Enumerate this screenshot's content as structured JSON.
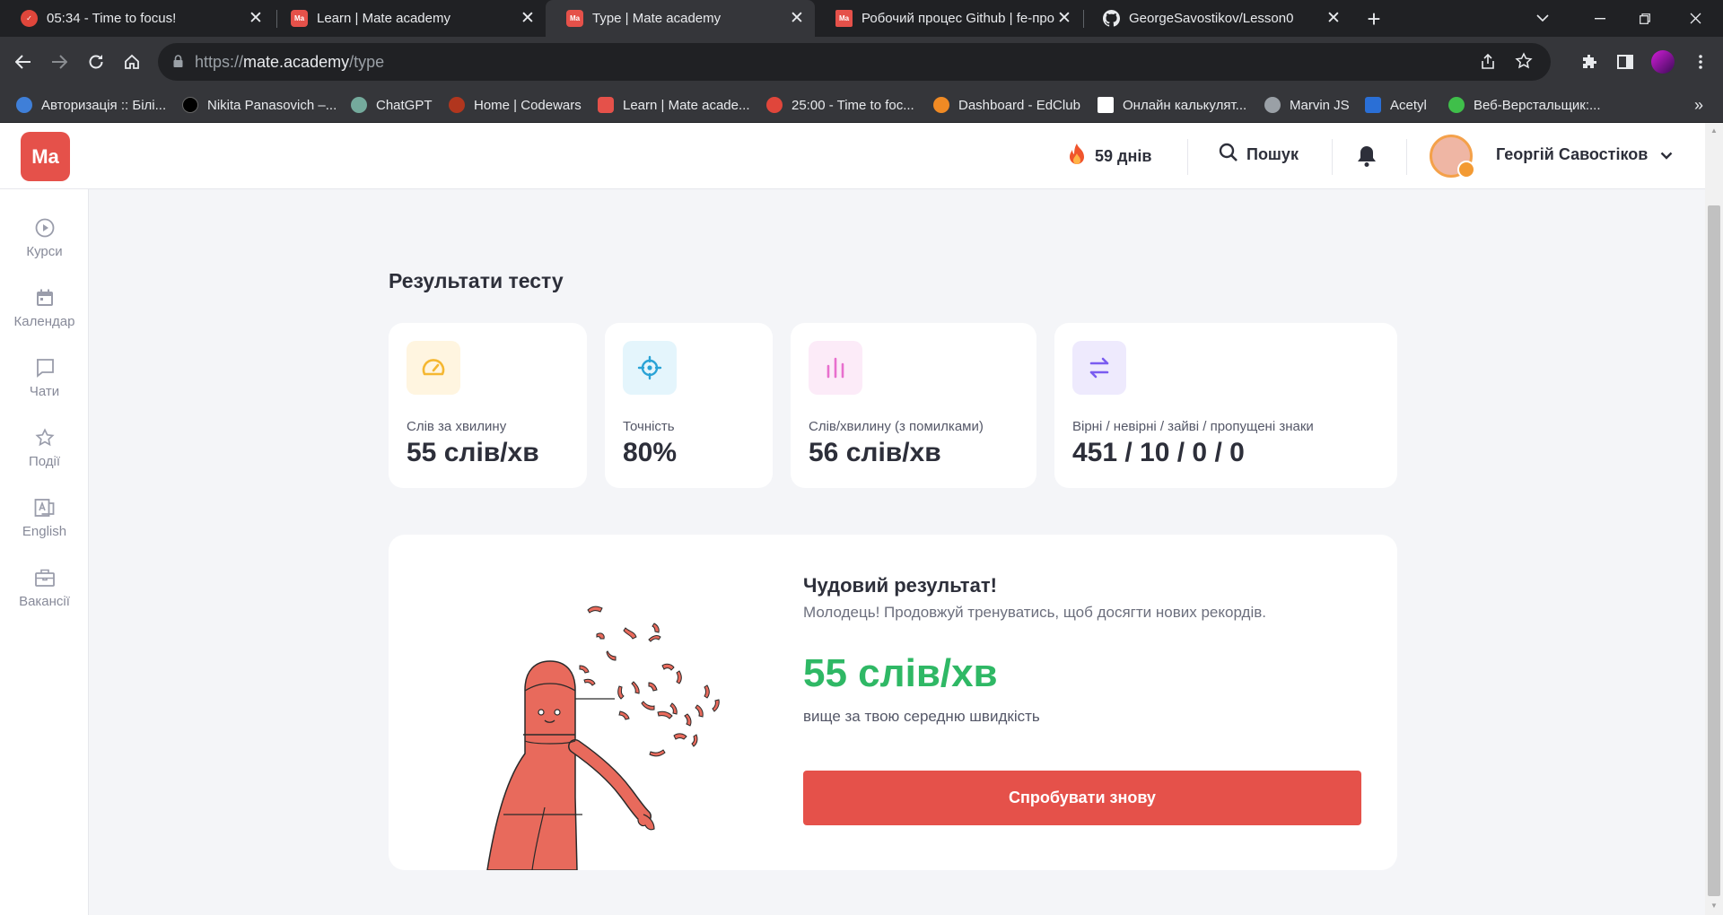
{
  "browser": {
    "tabs": [
      {
        "title": "05:34 - Time to focus!",
        "favicon": "pomodoro-icon"
      },
      {
        "title": "Learn | Mate academy",
        "favicon": "mate-icon"
      },
      {
        "title": "Type | Mate academy",
        "favicon": "mate-icon",
        "active": true
      },
      {
        "title": "Робочий процес Github | fe-про",
        "favicon": "mate-icon"
      },
      {
        "title": "GeorgeSavostikov/Lesson0",
        "favicon": "github-icon"
      }
    ],
    "url_scheme": "https://",
    "url_host": "mate.academy",
    "url_path": "/type",
    "bookmarks": [
      {
        "label": "Авторизація :: Білі..."
      },
      {
        "label": "Nikita Panasovich –..."
      },
      {
        "label": "ChatGPT"
      },
      {
        "label": "Home | Codewars"
      },
      {
        "label": "Learn | Mate acade..."
      },
      {
        "label": "25:00 - Time to foc..."
      },
      {
        "label": "Dashboard - EdClub"
      },
      {
        "label": "Онлайн калькулят..."
      },
      {
        "label": "Marvin JS"
      },
      {
        "label": "Acetyl"
      },
      {
        "label": "Веб-Верстальщик:..."
      }
    ],
    "more_bookmarks": "»"
  },
  "header": {
    "logo": "Ma",
    "streak": "59 днів",
    "search": "Пошук",
    "user_name": "Георгій Савостіков"
  },
  "sidebar": {
    "items": [
      {
        "label": "Курси",
        "icon": "play-circle-icon"
      },
      {
        "label": "Календар",
        "icon": "calendar-icon"
      },
      {
        "label": "Чати",
        "icon": "chat-icon"
      },
      {
        "label": "Події",
        "icon": "star-icon"
      },
      {
        "label": "English",
        "icon": "english-icon"
      },
      {
        "label": "Вакансії",
        "icon": "briefcase-icon"
      }
    ]
  },
  "results": {
    "title": "Результати тесту",
    "cards": [
      {
        "label": "Слів за хвилину",
        "value": "55 слів/хв",
        "icon": "speedometer-icon",
        "color": "#f5b731"
      },
      {
        "label": "Точність",
        "value": "80%",
        "icon": "target-icon",
        "color": "#2aa3d6"
      },
      {
        "label": "Слів/хвилину (з помилками)",
        "value": "56 слів/хв",
        "icon": "bar-chart-icon",
        "color": "#e86fce"
      },
      {
        "label": "Вірні / невірні / зайві / пропущені знаки",
        "value": "451 / 10 / 0 / 0",
        "icon": "swap-arrows-icon",
        "color": "#7a5cf0"
      }
    ]
  },
  "summary": {
    "heading": "Чудовий результат!",
    "subtitle": "Молодець! Продовжуй тренуватись, щоб досягти нових рекордів.",
    "speed": "55 слів/хв",
    "note": "вище за твою середню швидкість",
    "button": "Спробувати знову"
  },
  "colors": {
    "brand": "#e5514a",
    "success": "#2fb865"
  }
}
